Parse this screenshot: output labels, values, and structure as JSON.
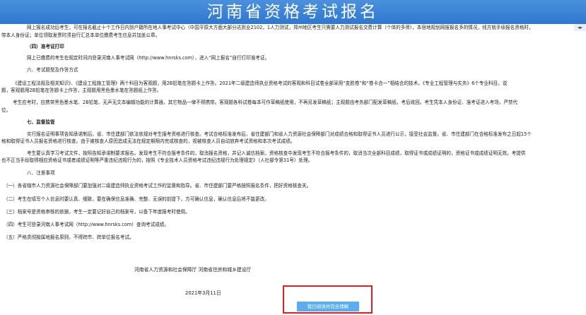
{
  "header": {
    "title": "河南省资格考试报名"
  },
  "content": {
    "l1": "网上报名成功后考生，可在报名截止十个工作日内到户籍所在地人事考试中心（中国平原大方面大部分达到业2102，1人力测试，郑州地区考生只需要人力测试报名交费计算（个体的多师），本宿地规划网报报名多的情况，线方就手续报名资格时，",
    "l2": "带本人身份证；单位领取发票时须自行汇总本单位缴费考生信息并加盖公章。",
    "h_ticket": "（四）准考证打印",
    "l_ticket": "网上已缴费的考生在规定时间内登录河南人事考试网（http://www.hnrsks.com），进入“网上报名”自行打印准考证。",
    "h6": "六、考试题型及作答方式",
    "l6a": "《建设工程法规及相关知识》、《建设工程施工管理》两个科目为客观题，用2B铅笔在答题卡上作答。2021年二级建造师执业资格考试的客观和科目试卷全部采用“变脸卷”和“卷卡合一”相结合的技术。《专业工程管理与实务》6个专业科目，说",
    "l6b": "题，客观题用2B铅笔在答题卡上作答，主观题用黑色墨水笔在答题纸上作答。",
    "l6c": "考生应考时，应携带黑色墨水笔、2B铅笔、无声无文本编辑功能的计算器，其它物品一律不得携带。客观题各科试卷每本可作草稿纸使用，不再另发草稿纸；主观题由考务部门配发草稿纸，考后收回。考生凭本人身份证、准考证进入考场，严禁代",
    "l6d": "位。",
    "h7": "七、监督监管",
    "l7a": "实行报名证明事项告知承诺制后，省、市住建部门依法依规对考生报考资格进行核查。考试合格标准发布后，省住建部门和省人力资源社会保障部门对成绩合格和取得证书人员进行公示，接受社会监督。省、市住建部门在合格标准发布之日起15个",
    "l7b": "格和取得证书人员报名资格进行核查。由于被核查人原因造成无法在规定期限内完成核查的，视被核查人员自动放弃考试资格和本次考试成绩。",
    "l7c": "考生要认真学习考试文件，按照告知承诺制要求报名。发现考生不符合报考条件的，取消报名资格，并记入诚信档案。资格核查中发现考生不符合报考条件的，取消当次全部科目成绩，取得证书或成绩证明的，资格证书或成绩证明无效。考提供",
    "l7d": "也不正当手段取得相应资格证书或者成绩证明等严重违纪违规行为的，按照《专业技术人员资格考试违纪违规行为处理规定》（人社部令第31号）处理。",
    "h8": "八、注意事项",
    "n1": "（一）各省辖市人力资源社会保障部门要加强对二级建造师执业资格考试工作的监督和指导。省、市住建部门要严格按照报名条件，把好资格核查关。",
    "n2": "（二）考生在填写个人信息时要认真、细致，要在确保信息准确、完整、无误的前提下，方可确认信息，确认信息后将不能更改。",
    "n3": "（三）档案号是资格审核的依据，考生一定要记好自己的档案号，以备下年度报考时使用。",
    "n4": "（四）考生可登录河南人事考试网（http://www.hnrsks.com）查询考试成绩。",
    "n5": "（五）严格贯彻按属地报名原则，不得跨市、跨单位报名考试。",
    "sign": "河南省人力资源和社会保障厅  河南省住房和城乡建设厅",
    "date": "2021年3月11日"
  },
  "actions": {
    "confirm_label": "我已阅读并完全理解"
  },
  "colors": {
    "banner": "#3a84d8",
    "button": "#5aaef0",
    "highlight": "#e02020"
  }
}
